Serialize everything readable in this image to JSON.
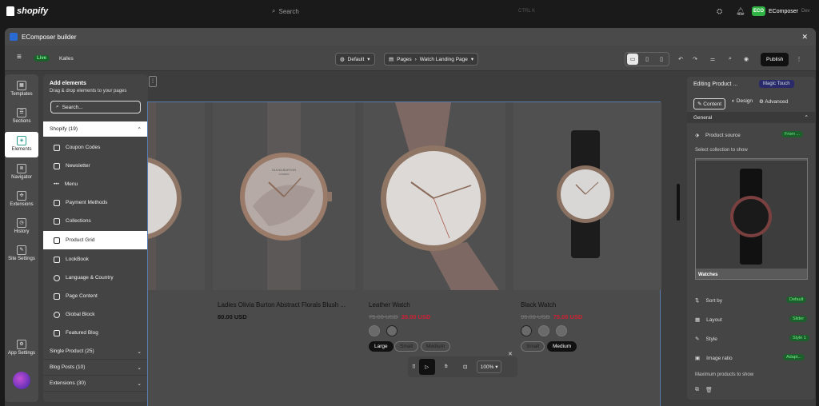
{
  "topbar": {
    "brand": "shopify",
    "search_placeholder": "Search",
    "kbd": "CTRL K",
    "store": {
      "initials": "ECO",
      "name": "EComposer",
      "sub": "Dev"
    }
  },
  "window": {
    "title": "EComposer builder"
  },
  "toolbar": {
    "live": "Live",
    "store": "Kalles",
    "view_default": "Default",
    "pages_crumb": "Pages",
    "page_name": "Watch Landing Page",
    "publish": "Publish"
  },
  "rail": [
    {
      "label": "Templates",
      "icon": "layout-icon"
    },
    {
      "label": "Sections",
      "icon": "grid-icon"
    },
    {
      "label": "Elements",
      "icon": "cube-icon"
    },
    {
      "label": "Navigator",
      "icon": "list-icon"
    },
    {
      "label": "Extensions",
      "icon": "puzzle-icon"
    },
    {
      "label": "History",
      "icon": "clock-icon"
    },
    {
      "label": "Site Settings",
      "icon": "brush-icon"
    },
    {
      "label": "App Settings",
      "icon": "gear-icon"
    }
  ],
  "panel": {
    "title": "Add elements",
    "subtitle": "Drag & drop elements to your pages",
    "search": "Search...",
    "shopify_group": "Shopify (19)",
    "elements": [
      "Coupon Codes",
      "Newsletter",
      "Menu",
      "Payment Methods",
      "Collections",
      "Product Grid",
      "LookBook",
      "Language & Country",
      "Page Content",
      "Global Block",
      "Featured Blog"
    ],
    "groups": [
      "Single Product (25)",
      "Blog Posts (10)",
      "Extensions (30)"
    ]
  },
  "products": [
    {
      "title": "Ladies Olivia Burton Abstract Florals Blush ...",
      "price": "80.00 USD",
      "old": "",
      "sizes": []
    },
    {
      "title": "Leather Watch",
      "old": "75.00 USD",
      "price": "35.00 USD",
      "sizes": [
        "Large",
        "Small",
        "Medium"
      ],
      "selected": "Large"
    },
    {
      "title": "Black Watch",
      "old": "95.00 USD",
      "price": "75.00 USD",
      "sizes": [
        "Small",
        "Medium"
      ],
      "selected": "Medium"
    }
  ],
  "watch_brand": "OLIVIA BURTON",
  "watch_brand_sub": "LONDON",
  "dock": {
    "zoom": "100%"
  },
  "right": {
    "title": "Editing Product ...",
    "magic": "Magic Touch",
    "tabs": [
      "Content",
      "Design",
      "Advanced"
    ],
    "section": "General",
    "product_source": "Product source",
    "source_val": "From ...",
    "select_collection": "Select collection to show",
    "collection": "Watches",
    "rows": [
      {
        "label": "Sort by",
        "val": "Default"
      },
      {
        "label": "Layout",
        "val": "Slider"
      },
      {
        "label": "Style",
        "val": "Style 1"
      },
      {
        "label": "Image ratio",
        "val": "Adapt..."
      }
    ],
    "max": "Maximum products to show"
  },
  "colors": {
    "accent": "#2a6bd3",
    "live": "#2fb344",
    "sale": "#c23"
  }
}
